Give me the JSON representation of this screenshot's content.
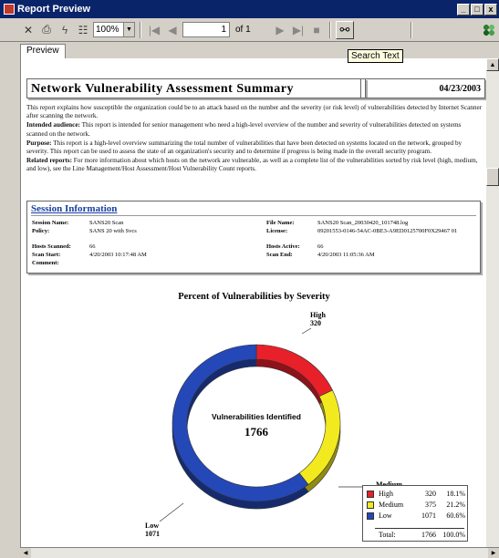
{
  "window": {
    "title": "Report Preview",
    "min": "_",
    "max": "□",
    "close": "x"
  },
  "toolbar": {
    "zoom": "100%",
    "page_current": "1",
    "page_of": "of 1",
    "tooltip": "Search Text"
  },
  "tabs": [
    {
      "label": "Preview"
    }
  ],
  "report": {
    "title": "Network Vulnerability Assessment Summary",
    "date": "04/23/2003",
    "intro": "This report explains how susceptible the organization could be to an attack based on the number and the severity (or risk level) of vulnerabilities detected by Internet Scanner after scanning the network.",
    "audience_label": "Intended audience:",
    "audience_text": "This report is intended for senior management who need a high-level overview of the number and severity of vulnerabilities detected on systems scanned on the network.",
    "purpose_label": "Purpose:",
    "purpose_text": "This report is a high-level overview summarizing the total number of vulnerabilities that have been detected on systems located on the network, grouped by severity. This report can be used to assess the state of an organization's security and to determine if progress is being made in the overall security program.",
    "related_label": "Related reports:",
    "related_text": "For more information about which hosts on the network are vulnerable, as well as a complete list of the vulnerabilities sorted by risk level (high, medium, and low), see the Line Management/Host Assessment/Host Vulnerability Count reports."
  },
  "session": {
    "title": "Session Information",
    "session_name_label": "Session Name:",
    "session_name": "SANS20 Scan",
    "policy_label": "Policy:",
    "policy": "SANS 20 with Svcs",
    "hosts_scanned_label": "Hosts Scanned:",
    "hosts_scanned": "66",
    "scan_start_label": "Scan Start:",
    "scan_start": "4/20/2003 10:17:48 AM",
    "comment_label": "Comment:",
    "file_name_label": "File Name:",
    "file_name": "SANS20 Scan_20030420_101748.log",
    "license_label": "License:",
    "license": "09201553-0146-54AC-0BE3-A9ED0125700F0X29467 01",
    "hosts_active_label": "Hosts Active:",
    "hosts_active": "66",
    "scan_end_label": "Scan End:",
    "scan_end": "4/20/2003 11:05:36 AM"
  },
  "chart_data": {
    "type": "pie",
    "title": "Percent of Vulnerabilities by Severity",
    "center_label": "Vulnerabilities Identified",
    "center_value": "1766",
    "series": [
      {
        "name": "High",
        "value": 320,
        "pct": "18.1%",
        "color": "#e8202a"
      },
      {
        "name": "Medium",
        "value": 375,
        "pct": "21.2%",
        "color": "#f2ea1e"
      },
      {
        "name": "Low",
        "value": 1071,
        "pct": "60.6%",
        "color": "#2448b8"
      }
    ],
    "total_label": "Total:",
    "total_value": "1766",
    "total_pct": "100.0%",
    "legend_position": "bottom-right"
  }
}
